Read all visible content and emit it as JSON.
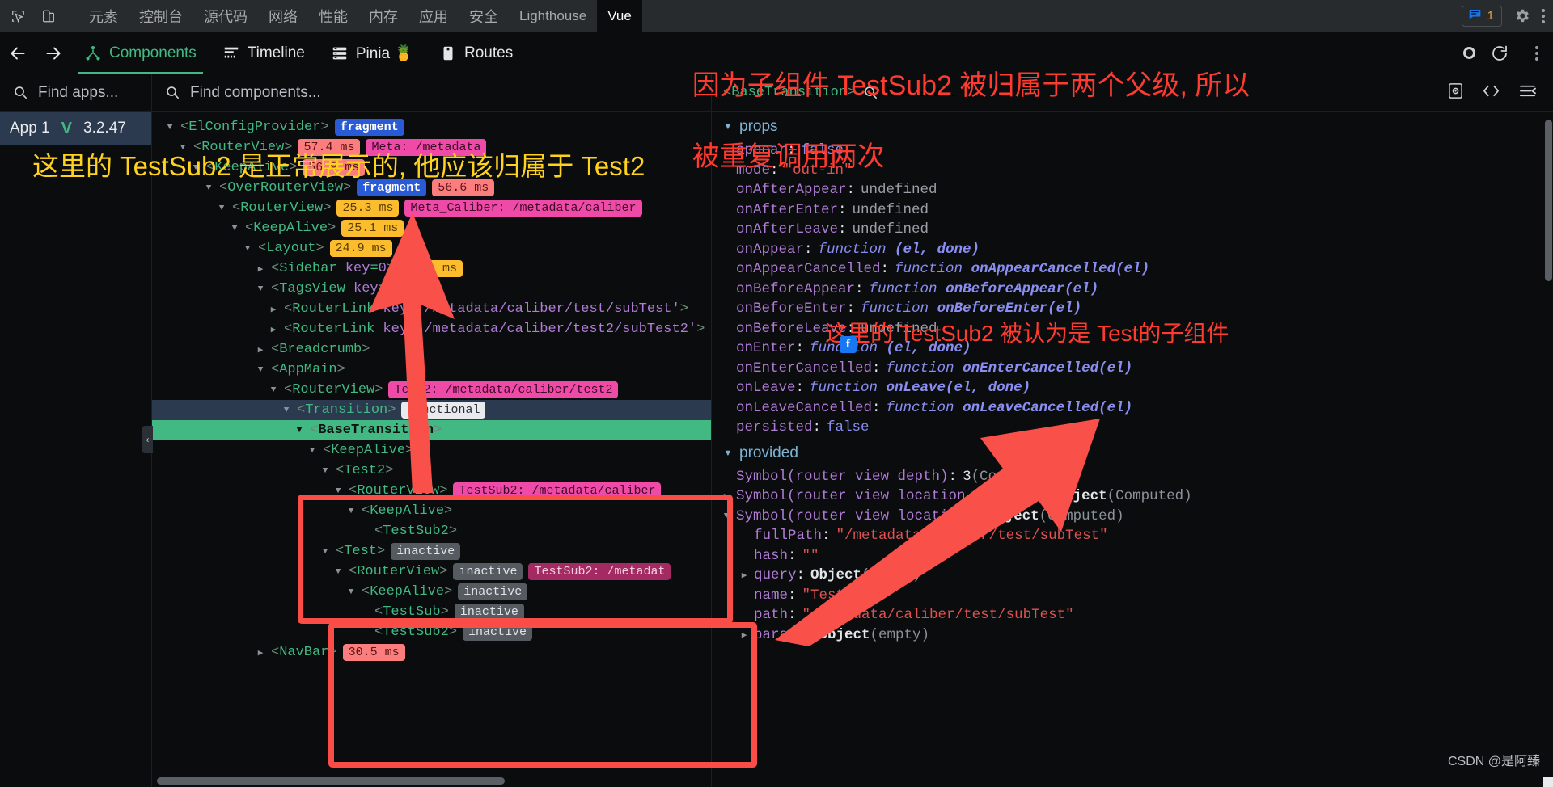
{
  "devtools_bar": {
    "icons": [
      "inspect-element-icon",
      "device-toolbar-icon"
    ],
    "tabs": [
      {
        "label": "元素",
        "active": false
      },
      {
        "label": "控制台",
        "active": false
      },
      {
        "label": "源代码",
        "active": false
      },
      {
        "label": "网络",
        "active": false
      },
      {
        "label": "性能",
        "active": false
      },
      {
        "label": "内存",
        "active": false
      },
      {
        "label": "应用",
        "active": false
      },
      {
        "label": "安全",
        "active": false
      },
      {
        "label": "Lighthouse",
        "active": false
      },
      {
        "label": "Vue",
        "active": true
      }
    ],
    "issues_count": "1",
    "issues_icon": "message-icon",
    "settings_icon": "gear-icon",
    "more_icon": "kebab-menu-icon"
  },
  "vue_toolbar": {
    "back_icon": "arrow-left-icon",
    "forward_icon": "arrow-right-icon",
    "tabs": [
      {
        "label": "Components",
        "icon": "components-tree-icon",
        "active": true
      },
      {
        "label": "Timeline",
        "icon": "timeline-icon",
        "active": false
      },
      {
        "label": "Pinia 🍍",
        "icon": "pinia-list-icon",
        "active": false
      },
      {
        "label": "Routes",
        "icon": "routes-icon",
        "active": false
      }
    ],
    "record_icon": "record-dot-icon",
    "refresh_icon": "refresh-icon",
    "menu_icon": "kebab-menu-icon"
  },
  "apps_pane": {
    "search_placeholder": "Find apps...",
    "selected_app": {
      "name": "App 1",
      "version": "3.2.47"
    }
  },
  "tree_pane": {
    "search_placeholder": "Find components...",
    "rows": [
      {
        "indent": 0,
        "caret": "down",
        "tag": "ElConfigProvider",
        "badges": [
          {
            "type": "fragment",
            "text": "fragment"
          }
        ]
      },
      {
        "indent": 1,
        "caret": "down",
        "tag": "RouterView",
        "badges": [
          {
            "type": "ms-red",
            "text": "57.4 ms"
          },
          {
            "type": "route",
            "text": "Meta: /metadata"
          }
        ]
      },
      {
        "indent": 2,
        "caret": "down",
        "tag": "KeepAlive",
        "badges": [
          {
            "type": "ms-red",
            "text": "56.9 ms"
          }
        ]
      },
      {
        "indent": 3,
        "caret": "down",
        "tag": "OverRouterView",
        "badges": [
          {
            "type": "fragment",
            "text": "fragment"
          },
          {
            "type": "ms-red",
            "text": "56.6 ms"
          }
        ]
      },
      {
        "indent": 4,
        "caret": "down",
        "tag": "RouterView",
        "badges": [
          {
            "type": "ms-orange",
            "text": "25.3 ms"
          },
          {
            "type": "route",
            "text": "Meta_Caliber: /metadata/caliber"
          }
        ]
      },
      {
        "indent": 5,
        "caret": "down",
        "tag": "KeepAlive",
        "badges": [
          {
            "type": "ms-orange",
            "text": "25.1 ms"
          }
        ]
      },
      {
        "indent": 6,
        "caret": "down",
        "tag": "Layout",
        "badges": [
          {
            "type": "ms-orange",
            "text": "24.9 ms"
          }
        ]
      },
      {
        "indent": 7,
        "caret": "right",
        "tag": "Sidebar",
        "attr_key": "key",
        "attr_val": "0",
        "badges": [
          {
            "type": "ms-orange",
            "text": "16.1 ms"
          }
        ]
      },
      {
        "indent": 7,
        "caret": "down",
        "tag": "TagsView",
        "attr_key": "key",
        "attr_val": "1",
        "badges": []
      },
      {
        "indent": 8,
        "caret": "right",
        "tag": "RouterLink",
        "attr_key": "key",
        "attr_val": "'/metadata/caliber/test/subTest'",
        "badges": []
      },
      {
        "indent": 8,
        "caret": "right",
        "tag": "RouterLink",
        "attr_key": "key",
        "attr_val": "'/metadata/caliber/test2/subTest2'",
        "badges": []
      },
      {
        "indent": 7,
        "caret": "right",
        "tag": "Breadcrumb",
        "badges": []
      },
      {
        "indent": 7,
        "caret": "down",
        "tag": "AppMain",
        "badges": []
      },
      {
        "indent": 8,
        "caret": "down",
        "tag": "RouterView",
        "badges": [
          {
            "type": "route",
            "text": "Test2: /metadata/caliber/test2"
          }
        ]
      },
      {
        "indent": 9,
        "caret": "down",
        "tag": "Transition",
        "badges": [
          {
            "type": "functional",
            "text": "functional"
          }
        ],
        "highlight": "dark"
      },
      {
        "indent": 10,
        "caret": "down",
        "tag": "BaseTransition",
        "badges": [],
        "highlight": "green"
      },
      {
        "indent": 11,
        "caret": "down",
        "tag": "KeepAlive",
        "badges": []
      },
      {
        "indent": 12,
        "caret": "down",
        "tag": "Test2",
        "badges": []
      },
      {
        "indent": 13,
        "caret": "down",
        "tag": "RouterView",
        "badges": [
          {
            "type": "route",
            "text": "TestSub2: /metadata/caliber"
          }
        ]
      },
      {
        "indent": 14,
        "caret": "down",
        "tag": "KeepAlive",
        "badges": []
      },
      {
        "indent": 15,
        "caret": "none",
        "tag": "TestSub2",
        "badges": []
      },
      {
        "indent": 12,
        "caret": "down",
        "tag": "Test",
        "badges": [
          {
            "type": "inactive",
            "text": "inactive"
          }
        ]
      },
      {
        "indent": 13,
        "caret": "down",
        "tag": "RouterView",
        "badges": [
          {
            "type": "inactive",
            "text": "inactive"
          },
          {
            "type": "route-dim",
            "text": "TestSub2: /metadat"
          }
        ]
      },
      {
        "indent": 14,
        "caret": "down",
        "tag": "KeepAlive",
        "badges": [
          {
            "type": "inactive",
            "text": "inactive"
          }
        ]
      },
      {
        "indent": 15,
        "caret": "none",
        "tag": "TestSub",
        "badges": [
          {
            "type": "inactive",
            "text": "inactive"
          }
        ]
      },
      {
        "indent": 15,
        "caret": "none",
        "tag": "TestSub2",
        "badges": [
          {
            "type": "inactive",
            "text": "inactive"
          }
        ]
      },
      {
        "indent": 7,
        "caret": "right",
        "tag": "NavBar",
        "badges": [
          {
            "type": "ms-red",
            "text": "30.5 ms"
          }
        ]
      }
    ]
  },
  "state_pane": {
    "selected_component": "BaseTransition",
    "filter_placeholder": "Filter state...",
    "head_icons": [
      "inspect-dom-icon",
      "open-in-editor-icon",
      "collapse-all-icon"
    ],
    "sections": [
      {
        "title": "props",
        "caret": "down",
        "entries": [
          {
            "key": "appear",
            "value": "false",
            "kind": "bool"
          },
          {
            "key": "mode",
            "value": "\"out-in\"",
            "kind": "str"
          },
          {
            "key": "onAfterAppear",
            "value": "undefined",
            "kind": "undef"
          },
          {
            "key": "onAfterEnter",
            "value": "undefined",
            "kind": "undef"
          },
          {
            "key": "onAfterLeave",
            "value": "undefined",
            "kind": "undef"
          },
          {
            "key": "onAppear",
            "value": "function (el, done)",
            "kind": "fn",
            "fn_prefix": "function ",
            "fn_name": "(el, done)"
          },
          {
            "key": "onAppearCancelled",
            "value": "function onAppearCancelled(el)",
            "kind": "fn",
            "fn_prefix": "function ",
            "fn_name": "onAppearCancelled(el)"
          },
          {
            "key": "onBeforeAppear",
            "value": "function onBeforeAppear(el)",
            "kind": "fn",
            "fn_prefix": "function ",
            "fn_name": "onBeforeAppear(el)"
          },
          {
            "key": "onBeforeEnter",
            "value": "function onBeforeEnter(el)",
            "kind": "fn",
            "fn_prefix": "function ",
            "fn_name": "onBeforeEnter(el)"
          },
          {
            "key": "onBeforeLeave",
            "value": "undefined",
            "kind": "undef"
          },
          {
            "key": "onEnter",
            "value": "function (el, done)",
            "kind": "fn",
            "fn_prefix": "function ",
            "fn_name": "(el, done)"
          },
          {
            "key": "onEnterCancelled",
            "value": "function onEnterCancelled(el)",
            "kind": "fn",
            "fn_prefix": "function ",
            "fn_name": "onEnterCancelled(el)"
          },
          {
            "key": "onLeave",
            "value": "function onLeave(el, done)",
            "kind": "fn",
            "fn_prefix": "function ",
            "fn_name": "onLeave(el, done)"
          },
          {
            "key": "onLeaveCancelled",
            "value": "function onLeaveCancelled(el)",
            "kind": "fn",
            "fn_prefix": "function ",
            "fn_name": "onLeaveCancelled(el)"
          },
          {
            "key": "persisted",
            "value": "false",
            "kind": "bool"
          }
        ]
      },
      {
        "title": "provided",
        "caret": "down",
        "entries": [
          {
            "key": "Symbol(router view depth)",
            "value": "3",
            "kind": "num",
            "note": "(Computed)"
          },
          {
            "key": "Symbol(router view location matched)",
            "value": "Object",
            "kind": "obj",
            "note": "(Computed)",
            "caret": "right"
          },
          {
            "key": "Symbol(router view location)",
            "value": "Object",
            "kind": "obj",
            "note": "(Computed)",
            "caret": "down"
          },
          {
            "key": "fullPath",
            "value": "\"/metadata/caliber/test/subTest\"",
            "kind": "str",
            "indent": 1
          },
          {
            "key": "hash",
            "value": "\"\"",
            "kind": "str",
            "indent": 1
          },
          {
            "key": "query",
            "value": "Object",
            "kind": "obj",
            "note": "(empty)",
            "caret": "right",
            "indent": 1
          },
          {
            "key": "name",
            "value": "\"TestSub\"",
            "kind": "str",
            "indent": 1
          },
          {
            "key": "path",
            "value": "\"/metadata/caliber/test/subTest\"",
            "kind": "str",
            "indent": 1
          },
          {
            "key": "params",
            "value": "Object",
            "kind": "obj",
            "note": "(empty)",
            "caret": "right",
            "indent": 1
          }
        ]
      }
    ]
  },
  "annotations": {
    "red_top_line1": "因为子组件 TestSub2 被归属于两个父级, 所以",
    "red_top_line2": "被重复调用两次",
    "yellow_left": "这里的 TestSub2 是正常展示的, 他应该归属于 Test2",
    "red_middle": "这里的 TestSub2 被认为是 Test的子组件",
    "accent_red": "#ff3b30",
    "accent_yellow": "#ffd21e",
    "box_color": "#fb4d47",
    "arrow_color": "#f9504a"
  },
  "watermark": "CSDN @是阿臻"
}
